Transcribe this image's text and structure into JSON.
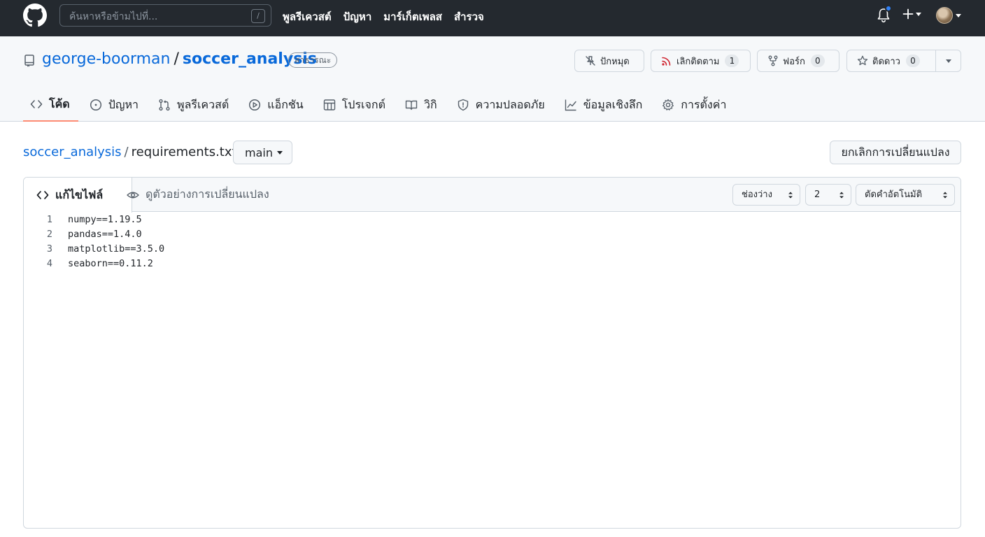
{
  "header": {
    "search_placeholder": "ค้นหาหรือข้ามไปที่...",
    "search_shortcut": "/",
    "nav": [
      "พูลรีเควสต์",
      "ปัญหา",
      "มาร์เก็ตเพลส",
      "สำรวจ"
    ],
    "icons": [
      "github-logo-icon",
      "bell-icon",
      "plus-icon",
      "chevron-down-icon",
      "avatar"
    ],
    "accent": "#2f81f7",
    "background": "#24292f"
  },
  "repo": {
    "owner": "george-boorman",
    "separator": "/",
    "name": "soccer_analysis",
    "visibility": "สาธารณะ",
    "actions": {
      "pin": {
        "label": "ปักหมุด"
      },
      "watch": {
        "label": "เลิกติดตาม",
        "count": "1"
      },
      "fork": {
        "label": "ฟอร์ก",
        "count": "0"
      },
      "star": {
        "label": "ติดดาว",
        "count": "0"
      }
    },
    "tabs": [
      {
        "label": "โค้ด",
        "icon": "code-icon",
        "selected": true
      },
      {
        "label": "ปัญหา",
        "icon": "issue-icon"
      },
      {
        "label": "พูลรีเควสต์",
        "icon": "pull-request-icon"
      },
      {
        "label": "แอ็กชัน",
        "icon": "play-icon"
      },
      {
        "label": "โปรเจกต์",
        "icon": "table-icon"
      },
      {
        "label": "วิกิ",
        "icon": "book-icon"
      },
      {
        "label": "ความปลอดภัย",
        "icon": "shield-icon"
      },
      {
        "label": "ข้อมูลเชิงลึก",
        "icon": "graph-icon"
      },
      {
        "label": "การตั้งค่า",
        "icon": "gear-icon"
      }
    ],
    "tab_underline_color": "#fd8c73"
  },
  "file": {
    "repo_link": "soccer_analysis",
    "separator": "/",
    "filename": "requirements.txt",
    "branch": "main",
    "cancel_label": "ยกเลิกการเปลี่ยนแปลง"
  },
  "editor": {
    "tab_edit": "แก้ไขไฟล์",
    "tab_preview": "ดูตัวอย่างการเปลี่ยนแปลง",
    "indent_mode": "ช่องว่าง",
    "indent_size": "2",
    "wrap_mode": "ตัดคำอัตโนมัติ",
    "lines": [
      {
        "n": "1",
        "text": "numpy==1.19.5"
      },
      {
        "n": "2",
        "text": "pandas==1.4.0"
      },
      {
        "n": "3",
        "text": "matplotlib==3.5.0"
      },
      {
        "n": "4",
        "text": "seaborn==0.11.2"
      }
    ]
  }
}
